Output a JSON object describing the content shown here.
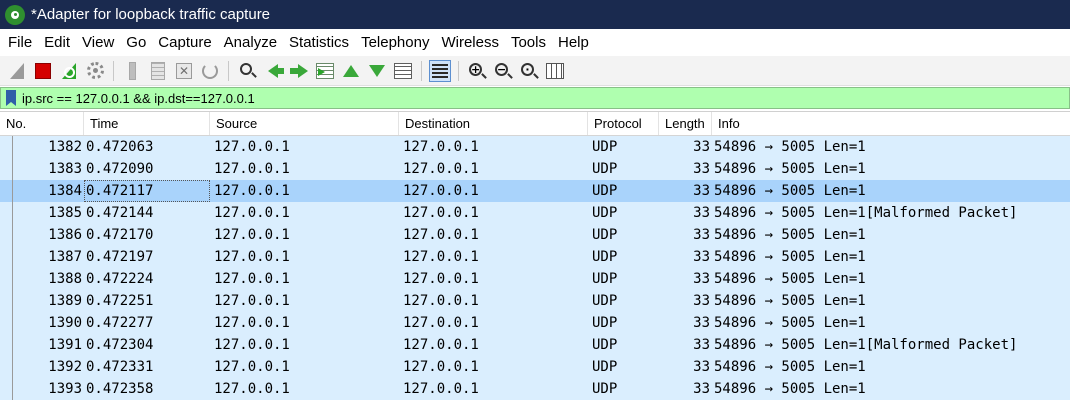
{
  "window": {
    "title": "*Adapter for loopback traffic capture"
  },
  "menu": [
    "File",
    "Edit",
    "View",
    "Go",
    "Capture",
    "Analyze",
    "Statistics",
    "Telephony",
    "Wireless",
    "Tools",
    "Help"
  ],
  "toolbar": {
    "icons": [
      "start-capture-icon",
      "stop-capture-icon",
      "restart-capture-icon",
      "capture-options-icon",
      "open-file-icon",
      "save-file-icon",
      "close-file-icon",
      "reload-file-icon",
      "find-packet-icon",
      "go-back-icon",
      "go-forward-icon",
      "go-to-packet-icon",
      "first-packet-icon",
      "last-packet-icon",
      "auto-scroll-icon",
      "colorize-icon",
      "zoom-in-icon",
      "zoom-out-icon",
      "zoom-normal-icon",
      "resize-columns-icon"
    ]
  },
  "filter": {
    "value": "ip.src == 127.0.0.1 && ip.dst==127.0.0.1"
  },
  "table": {
    "columns": [
      "No.",
      "Time",
      "Source",
      "Destination",
      "Protocol",
      "Length",
      "Info"
    ],
    "selected_index": 2,
    "rows": [
      {
        "no": "1382",
        "time": "0.472063",
        "src": "127.0.0.1",
        "dst": "127.0.0.1",
        "proto": "UDP",
        "len": "33",
        "info": "54896 → 5005 Len=1"
      },
      {
        "no": "1383",
        "time": "0.472090",
        "src": "127.0.0.1",
        "dst": "127.0.0.1",
        "proto": "UDP",
        "len": "33",
        "info": "54896 → 5005 Len=1"
      },
      {
        "no": "1384",
        "time": "0.472117",
        "src": "127.0.0.1",
        "dst": "127.0.0.1",
        "proto": "UDP",
        "len": "33",
        "info": "54896 → 5005 Len=1"
      },
      {
        "no": "1385",
        "time": "0.472144",
        "src": "127.0.0.1",
        "dst": "127.0.0.1",
        "proto": "UDP",
        "len": "33",
        "info": "54896 → 5005 Len=1[Malformed Packet]"
      },
      {
        "no": "1386",
        "time": "0.472170",
        "src": "127.0.0.1",
        "dst": "127.0.0.1",
        "proto": "UDP",
        "len": "33",
        "info": "54896 → 5005 Len=1"
      },
      {
        "no": "1387",
        "time": "0.472197",
        "src": "127.0.0.1",
        "dst": "127.0.0.1",
        "proto": "UDP",
        "len": "33",
        "info": "54896 → 5005 Len=1"
      },
      {
        "no": "1388",
        "time": "0.472224",
        "src": "127.0.0.1",
        "dst": "127.0.0.1",
        "proto": "UDP",
        "len": "33",
        "info": "54896 → 5005 Len=1"
      },
      {
        "no": "1389",
        "time": "0.472251",
        "src": "127.0.0.1",
        "dst": "127.0.0.1",
        "proto": "UDP",
        "len": "33",
        "info": "54896 → 5005 Len=1"
      },
      {
        "no": "1390",
        "time": "0.472277",
        "src": "127.0.0.1",
        "dst": "127.0.0.1",
        "proto": "UDP",
        "len": "33",
        "info": "54896 → 5005 Len=1"
      },
      {
        "no": "1391",
        "time": "0.472304",
        "src": "127.0.0.1",
        "dst": "127.0.0.1",
        "proto": "UDP",
        "len": "33",
        "info": "54896 → 5005 Len=1[Malformed Packet]"
      },
      {
        "no": "1392",
        "time": "0.472331",
        "src": "127.0.0.1",
        "dst": "127.0.0.1",
        "proto": "UDP",
        "len": "33",
        "info": "54896 → 5005 Len=1"
      },
      {
        "no": "1393",
        "time": "0.472358",
        "src": "127.0.0.1",
        "dst": "127.0.0.1",
        "proto": "UDP",
        "len": "33",
        "info": "54896 → 5005 Len=1"
      }
    ]
  },
  "colors": {
    "titlebar": "#1a2a4f",
    "filter_valid": "#afffaf",
    "udp_row": "#daeefe",
    "selected_row": "#a9d3fb"
  }
}
